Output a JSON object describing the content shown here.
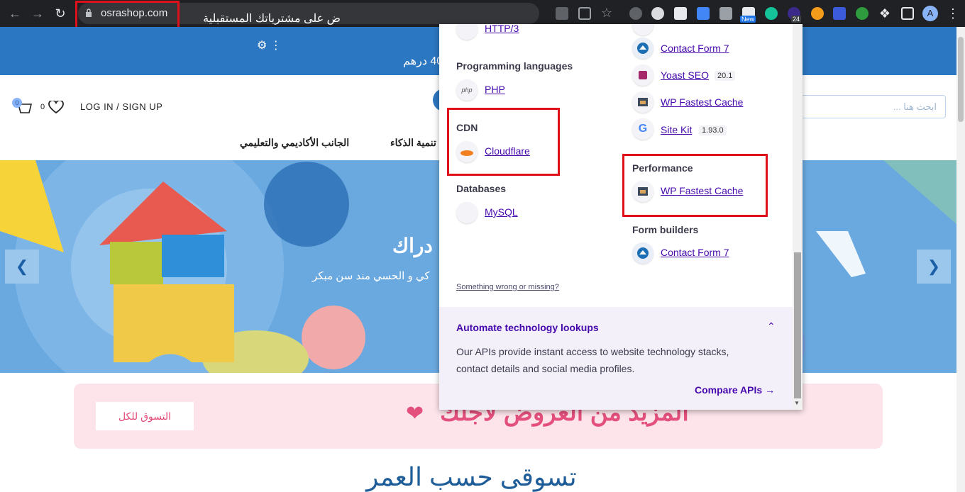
{
  "browser": {
    "url": "osrashop.com",
    "extension_badges": {
      "new": "New",
      "count": "24"
    },
    "profile_initial": "A"
  },
  "site": {
    "topbar_line1": "ض على مشترياتك المستقبلية",
    "topbar_line2": "40 درهم",
    "login": "LOG IN / SIGN UP",
    "cart_count": "0",
    "wishlist_count": "0",
    "search_placeholder": "ابحث هنا ...",
    "nav": [
      "الجانب الأكاديمي والتعليمي",
      "تنمية الذكاء"
    ],
    "hero_title": "دراك",
    "hero_subtitle": "كي و الحسي مند سن مبكر",
    "promo_button": "التسوق للكل",
    "promo_text": "المزيد من العروض لأجلك",
    "section_title": "تسوقى حسب العمر"
  },
  "popup": {
    "left": {
      "partial_item": "HTTP/3",
      "groups": [
        {
          "heading": "Programming languages",
          "items": [
            {
              "name": "PHP"
            }
          ]
        },
        {
          "heading": "CDN",
          "items": [
            {
              "name": "Cloudflare"
            }
          ]
        },
        {
          "heading": "Databases",
          "items": [
            {
              "name": "MySQL"
            }
          ]
        }
      ]
    },
    "right": {
      "top_items": [
        {
          "name": "Contact Form 7"
        },
        {
          "name": "Yoast SEO",
          "version": "20.1"
        },
        {
          "name": "WP Fastest Cache"
        },
        {
          "name": "Site Kit",
          "version": "1.93.0"
        }
      ],
      "groups": [
        {
          "heading": "Performance",
          "items": [
            {
              "name": "WP Fastest Cache"
            }
          ]
        },
        {
          "heading": "Form builders",
          "items": [
            {
              "name": "Contact Form 7"
            }
          ]
        }
      ]
    },
    "missing_link": "Something wrong or missing?",
    "automate": {
      "title": "Automate technology lookups",
      "text": "Our APIs provide instant access to website technology stacks, contact details and social media profiles.",
      "button": "Compare APIs"
    }
  },
  "colors": {
    "accent": "#4608ad",
    "highlight": "#e0101a",
    "site_blue": "#2c77c1"
  }
}
